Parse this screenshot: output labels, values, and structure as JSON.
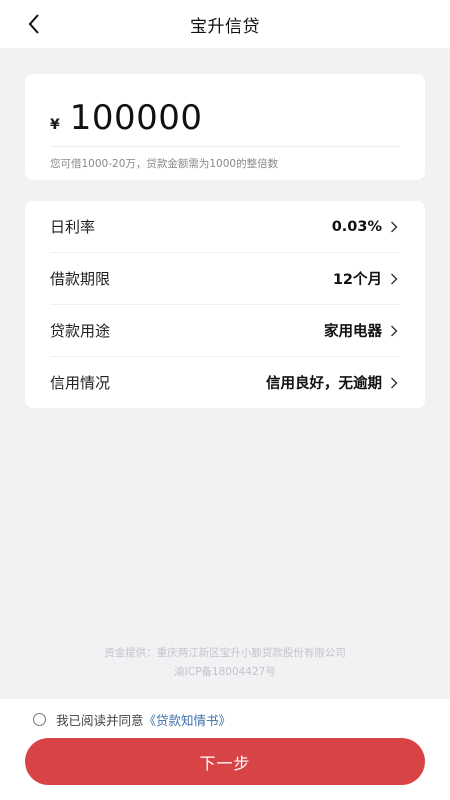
{
  "header": {
    "title": "宝升信贷"
  },
  "amount": {
    "currency_symbol": "¥",
    "value": "100000",
    "hint": "您可借1000-20万，贷款金额需为1000的整倍数"
  },
  "info_rows": [
    {
      "label": "日利率",
      "value": "0.03%"
    },
    {
      "label": "借款期限",
      "value": "12个月"
    },
    {
      "label": "贷款用途",
      "value": "家用电器"
    },
    {
      "label": "信用情况",
      "value": "信用良好，无逾期"
    }
  ],
  "footer": {
    "provider": "资金提供：重庆两江新区宝升小额贷款股份有限公司",
    "icp": "渝ICP备18004427号"
  },
  "agreement": {
    "text": "我已阅读并同意",
    "link": "《贷款知情书》"
  },
  "next_button": {
    "label": "下一步"
  },
  "colors": {
    "accent": "#d84446",
    "link": "#3d6fa8",
    "background": "#f2f2f4"
  }
}
